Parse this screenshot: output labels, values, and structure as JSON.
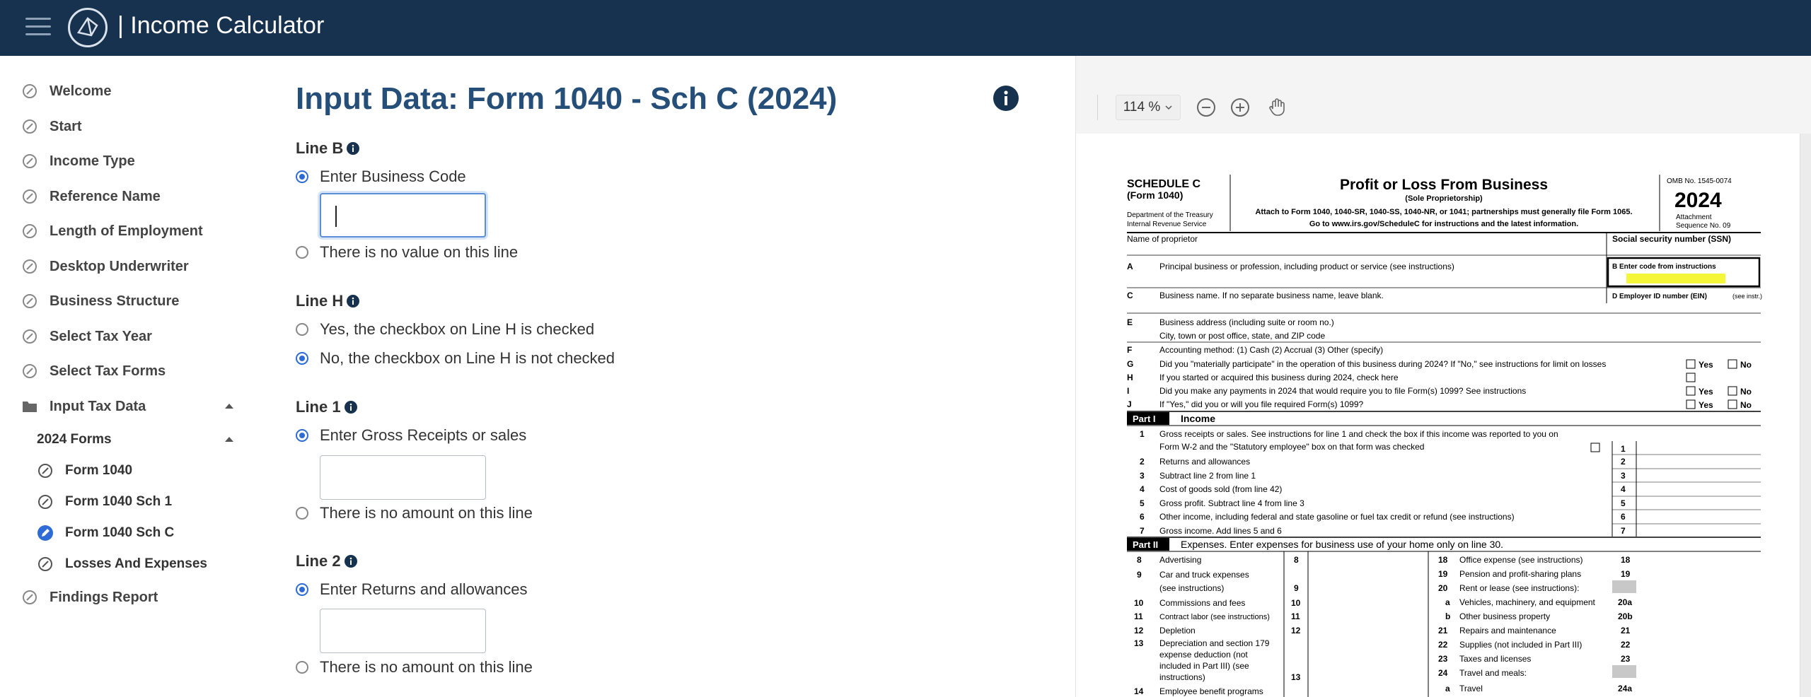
{
  "app": {
    "title": "| Income Calculator",
    "colors": {
      "header": "#17324f",
      "accent": "#254e78",
      "radio": "#2f6bd6",
      "highlight": "#f5f53a"
    }
  },
  "sidebar": {
    "items": [
      {
        "label": "Welcome",
        "icon": "circle-slash-icon"
      },
      {
        "label": "Start",
        "icon": "circle-slash-icon"
      },
      {
        "label": "Income Type",
        "icon": "circle-slash-icon"
      },
      {
        "label": "Reference Name",
        "icon": "circle-slash-icon"
      },
      {
        "label": "Length of Employment",
        "icon": "circle-slash-icon"
      },
      {
        "label": "Desktop Underwriter",
        "icon": "circle-slash-icon"
      },
      {
        "label": "Business Structure",
        "icon": "circle-slash-icon"
      },
      {
        "label": "Select Tax Year",
        "icon": "circle-slash-icon"
      },
      {
        "label": "Select Tax Forms",
        "icon": "circle-slash-icon"
      },
      {
        "label": "Input Tax Data",
        "icon": "folder-icon",
        "expanded": true
      }
    ],
    "group_label": "2024 Forms",
    "sub_items": [
      {
        "label": "Form 1040",
        "icon": "circle-slash-icon"
      },
      {
        "label": "Form 1040 Sch 1",
        "icon": "circle-slash-icon"
      },
      {
        "label": "Form 1040 Sch C",
        "icon": "pencil-icon",
        "active": true
      },
      {
        "label": "Losses And Expenses",
        "icon": "circle-slash-icon"
      }
    ],
    "footer_item": {
      "label": "Findings Report",
      "icon": "circle-slash-icon"
    }
  },
  "main": {
    "title": "Input Data: Form 1040 - Sch C (2024)",
    "lines": [
      {
        "label": "Line B",
        "option_enter": "Enter Business Code",
        "option_none": "There is no value on this line",
        "selected": "enter",
        "value": ""
      },
      {
        "label": "Line H",
        "option_yes": "Yes, the checkbox on Line H is checked",
        "option_no": "No, the checkbox on Line H is not checked",
        "selected": "no"
      },
      {
        "label": "Line 1",
        "option_enter": "Enter Gross Receipts or sales",
        "option_none": "There is no amount on this line",
        "selected": "enter",
        "value": ""
      },
      {
        "label": "Line 2",
        "option_enter": "Enter Returns and allowances",
        "option_none": "There is no amount on this line",
        "selected": "enter",
        "value": ""
      }
    ]
  },
  "viewer": {
    "zoom": "114 %",
    "form": {
      "sched": "SCHEDULE C",
      "form_no": "(Form 1040)",
      "dept1": "Department of the Treasury",
      "dept2": "Internal Revenue Service",
      "title": "Profit or Loss From Business",
      "subtitle": "(Sole Proprietorship)",
      "attach": "Attach to Form 1040, 1040-SR, 1040-SS, 1040-NR, or 1041; partnerships must generally file Form 1065.",
      "goto": "Go to www.irs.gov/ScheduleC for instructions and the latest information.",
      "omb": "OMB No. 1545-0074",
      "year": "2024",
      "attachment": "Attachment",
      "seq": "Sequence No. 09",
      "name_label": "Name of proprietor",
      "ssn_label": "Social security number (SSN)",
      "rows": [
        {
          "k": "A",
          "t": "Principal business or profession, including product or service (see instructions)"
        },
        {
          "k": "C",
          "t": "Business name. If no separate business name, leave blank."
        },
        {
          "k": "E",
          "t": "Business address (including suite or room no.)"
        },
        {
          "k": "",
          "t": "City, town or post office, state, and ZIP code"
        },
        {
          "k": "F",
          "t": "Accounting method:   (1)  Cash     (2)  Accrual     (3)  Other (specify)"
        },
        {
          "k": "G",
          "t": "Did you \"materially participate\" in the operation of this business during 2024? If \"No,\" see instructions for limit on losses"
        },
        {
          "k": "H",
          "t": "If you started or acquired this business during 2024, check here"
        },
        {
          "k": "I",
          "t": "Did you make any payments in 2024 that would require you to file Form(s) 1099? See instructions"
        },
        {
          "k": "J",
          "t": "If \"Yes,\" did you or will you file required Form(s) 1099?"
        }
      ],
      "box_b": "B  Enter code from instructions",
      "box_d": "D  Employer ID number (EIN)",
      "box_d_note": "(see instr.)",
      "yes": "Yes",
      "no": "No",
      "part1": "Part I",
      "part1_title": "Income",
      "income_lines": [
        {
          "n": "1",
          "t": "Gross receipts or sales. See instructions for line 1 and check the box if this income was reported to you on",
          "box": ""
        },
        {
          "n": "",
          "t": "Form W-2 and the \"Statutory employee\" box on that form was checked",
          "box": "1"
        },
        {
          "n": "2",
          "t": "Returns and allowances",
          "box": "2"
        },
        {
          "n": "3",
          "t": "Subtract line 2 from line 1",
          "box": "3"
        },
        {
          "n": "4",
          "t": "Cost of goods sold (from line 42)",
          "box": "4"
        },
        {
          "n": "5",
          "t": "Gross profit. Subtract line 4 from line 3",
          "box": "5"
        },
        {
          "n": "6",
          "t": "Other income, including federal and state gasoline or fuel tax credit or refund (see instructions)",
          "box": "6"
        },
        {
          "n": "7",
          "t": "Gross income. Add lines 5 and 6",
          "box": "7"
        }
      ],
      "part2": "Part II",
      "part2_title": "Expenses. Enter expenses for business use of your home only on line 30.",
      "exp_left": [
        {
          "n": "8",
          "t": "Advertising",
          "box": "8"
        },
        {
          "n": "9",
          "t": "Car and truck expenses",
          "box": ""
        },
        {
          "n": "",
          "t": "(see instructions)",
          "box": "9"
        },
        {
          "n": "10",
          "t": "Commissions and fees",
          "box": "10"
        },
        {
          "n": "11",
          "t": "Contract labor (see instructions)",
          "box": "11"
        },
        {
          "n": "12",
          "t": "Depletion",
          "box": "12"
        },
        {
          "n": "13",
          "t": "Depreciation and section 179",
          "box": ""
        },
        {
          "n": "",
          "t": "expense deduction (not",
          "box": ""
        },
        {
          "n": "",
          "t": "included in Part III) (see",
          "box": ""
        },
        {
          "n": "",
          "t": "instructions)",
          "box": "13"
        },
        {
          "n": "14",
          "t": "Employee benefit programs",
          "box": ""
        }
      ],
      "exp_right": [
        {
          "n": "18",
          "t": "Office expense (see instructions)",
          "box": "18"
        },
        {
          "n": "19",
          "t": "Pension and profit-sharing plans",
          "box": "19"
        },
        {
          "n": "20",
          "t": "Rent or lease (see instructions):",
          "box": ""
        },
        {
          "n": "a",
          "t": "Vehicles, machinery, and equipment",
          "box": "20a"
        },
        {
          "n": "b",
          "t": "Other business property",
          "box": "20b"
        },
        {
          "n": "21",
          "t": "Repairs and maintenance",
          "box": "21"
        },
        {
          "n": "22",
          "t": "Supplies (not included in Part III)",
          "box": "22"
        },
        {
          "n": "23",
          "t": "Taxes and licenses",
          "box": "23"
        },
        {
          "n": "24",
          "t": "Travel and meals:",
          "box": ""
        },
        {
          "n": "a",
          "t": "Travel",
          "box": "24a"
        }
      ]
    }
  }
}
